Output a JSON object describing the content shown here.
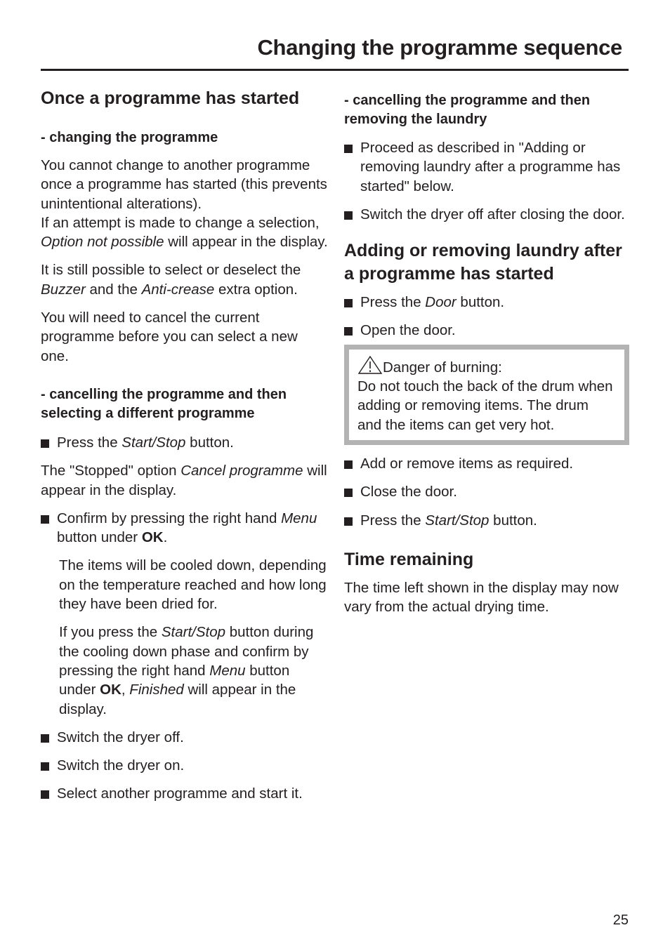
{
  "header": {
    "title": "Changing the programme sequence"
  },
  "left": {
    "heading": "Once a programme has started",
    "sub1": {
      "heading": "- changing the programme",
      "p1_a": "You cannot change to another programme once a programme has started (this prevents unintentional alterations).",
      "p1_b": "If an attempt is made to change a selection, ",
      "p1_c": "Option not possible",
      "p1_d": " will appear in the display.",
      "p2_a": "It is still possible to select or deselect the ",
      "p2_b": "Buzzer",
      "p2_c": " and the ",
      "p2_d": "Anti-crease",
      "p2_e": " extra option.",
      "p3": "You will need to cancel the current programme before you can select a new one."
    },
    "sub2": {
      "heading": "- cancelling the programme and then selecting a different programme",
      "b1_a": "Press the ",
      "b1_b": "Start/Stop",
      "b1_c": " button.",
      "p1_a": "The \"Stopped\" option ",
      "p1_b": "Cancel programme",
      "p1_c": " will appear in the display.",
      "b2_a": "Confirm by pressing the right hand ",
      "b2_b": "Menu",
      "b2_c": " button under ",
      "b2_d": "OK",
      "b2_e": ".",
      "i1": "The items will be cooled down, depending on the temperature reached and how long they have been dried for.",
      "i2_a": "If you press the ",
      "i2_b": "Start/Stop",
      "i2_c": " button during the cooling down phase and confirm by pressing the right hand ",
      "i2_d": "Menu",
      "i2_e": " button under ",
      "i2_f": "OK",
      "i2_g": ", ",
      "i2_h": "Finished",
      "i2_i": " will appear in the display.",
      "b3": "Switch the dryer off.",
      "b4": "Switch the dryer on.",
      "b5": "Select another programme and start it."
    }
  },
  "right": {
    "sub3": {
      "heading": "- cancelling the programme and then removing the laundry",
      "b1": "Proceed as described in \"Adding or removing laundry after a programme has started\" below.",
      "b2": "Switch the dryer off after closing the door."
    },
    "adding": {
      "heading": "Adding or removing laundry after a programme has started",
      "b1_a": "Press the ",
      "b1_b": "Door",
      "b1_c": " button.",
      "b2": "Open the door.",
      "warning": {
        "icon": "warning-triangle-icon",
        "title": "Danger of burning:",
        "text": "Do not touch the back of the drum when adding or removing items. The drum and the items can get very hot."
      },
      "b3": "Add or remove items as required.",
      "b4": "Close the door.",
      "b5_a": "Press the ",
      "b5_b": "Start/Stop",
      "b5_c": " button."
    },
    "time": {
      "heading": "Time remaining",
      "text": "The time left shown in the display may now vary from the actual drying time."
    }
  },
  "footer": {
    "page_number": "25"
  }
}
